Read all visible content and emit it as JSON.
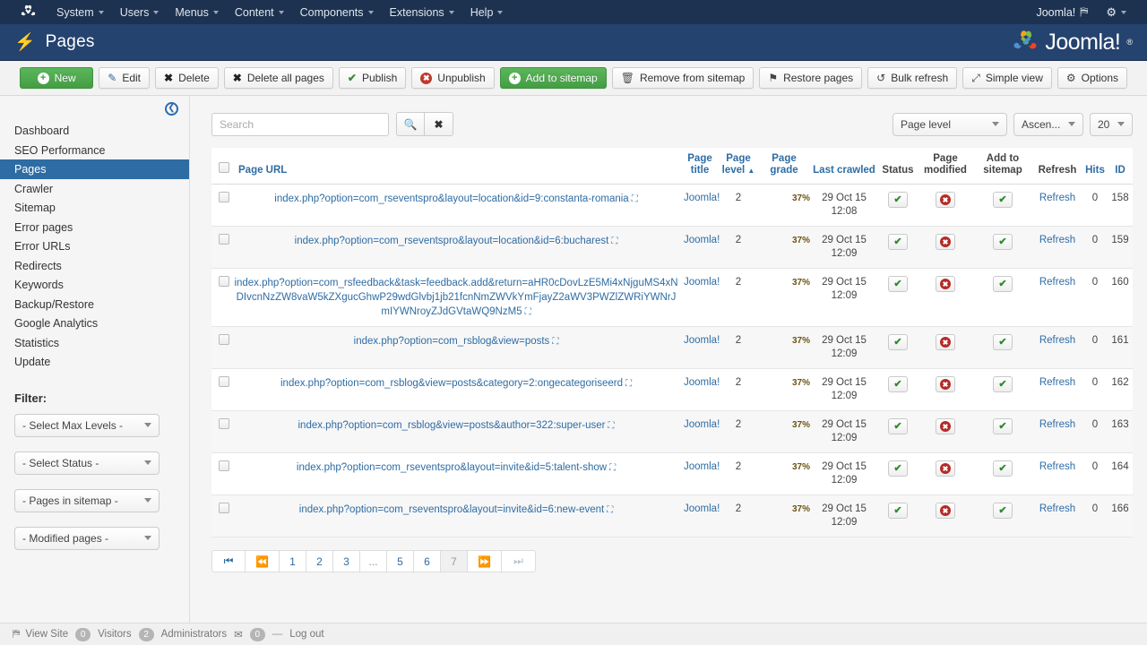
{
  "adminbar": {
    "logo_icon": "joomla-logo-icon",
    "menus": [
      {
        "label": "System"
      },
      {
        "label": "Users"
      },
      {
        "label": "Menus"
      },
      {
        "label": "Content"
      },
      {
        "label": "Components"
      },
      {
        "label": "Extensions"
      },
      {
        "label": "Help"
      }
    ],
    "site_name": "Joomla!",
    "site_preview_icon": "external-link-icon",
    "gear_icon": "gear-icon"
  },
  "header": {
    "icon": "bolt-icon",
    "title": "Pages",
    "brand": "Joomla!",
    "brand_tm": "®"
  },
  "toolbar": {
    "buttons": [
      {
        "label": "New",
        "icon": "plus-circle-icon",
        "style": "green"
      },
      {
        "label": "Edit",
        "icon": "edit-icon",
        "style": "default"
      },
      {
        "label": "Delete",
        "icon": "x-icon",
        "style": "default"
      },
      {
        "label": "Delete all pages",
        "icon": "x-icon",
        "style": "default"
      },
      {
        "label": "Publish",
        "icon": "check-icon",
        "style": "default"
      },
      {
        "label": "Unpublish",
        "icon": "ban-icon",
        "style": "default"
      },
      {
        "label": "Add to sitemap",
        "icon": "plus-circle-icon",
        "style": "green"
      },
      {
        "label": "Remove from sitemap",
        "icon": "trash-icon",
        "style": "default"
      },
      {
        "label": "Restore pages",
        "icon": "flag-icon",
        "style": "default"
      },
      {
        "label": "Bulk refresh",
        "icon": "refresh-icon",
        "style": "default"
      },
      {
        "label": "Simple view",
        "icon": "arrows-icon",
        "style": "default"
      },
      {
        "label": "Options",
        "icon": "gear-icon",
        "style": "default"
      }
    ]
  },
  "sidebar": {
    "collapse_icon": "collapse-left-icon",
    "items": [
      {
        "label": "Dashboard",
        "active": false
      },
      {
        "label": "SEO Performance",
        "active": false
      },
      {
        "label": "Pages",
        "active": true
      },
      {
        "label": "Crawler",
        "active": false
      },
      {
        "label": "Sitemap",
        "active": false
      },
      {
        "label": "Error pages",
        "active": false
      },
      {
        "label": "Error URLs",
        "active": false
      },
      {
        "label": "Redirects",
        "active": false
      },
      {
        "label": "Keywords",
        "active": false
      },
      {
        "label": "Backup/Restore",
        "active": false
      },
      {
        "label": "Google Analytics",
        "active": false
      },
      {
        "label": "Statistics",
        "active": false
      },
      {
        "label": "Update",
        "active": false
      }
    ],
    "filter_heading": "Filter:",
    "filters": [
      {
        "value": "- Select Max Levels -"
      },
      {
        "value": "- Select Status -"
      },
      {
        "value": "- Pages in sitemap -"
      },
      {
        "value": "- Modified pages -"
      }
    ]
  },
  "search": {
    "value": "",
    "placeholder": "Search",
    "search_icon": "search-icon",
    "clear_icon": "close-icon"
  },
  "topfilters": [
    {
      "value": "Page level"
    },
    {
      "value": "Ascen..."
    },
    {
      "value": "20"
    }
  ],
  "table": {
    "columns": [
      {
        "label": "Page URL",
        "sortable": true
      },
      {
        "label": "Page title",
        "sortable": true
      },
      {
        "label": "Page level",
        "sortable": true,
        "sorted": "asc"
      },
      {
        "label": "Page grade",
        "sortable": true
      },
      {
        "label": "Last crawled",
        "sortable": true
      },
      {
        "label": "Status",
        "sortable": false
      },
      {
        "label": "Page modified",
        "sortable": false
      },
      {
        "label": "Add to sitemap",
        "sortable": false
      },
      {
        "label": "Refresh",
        "sortable": false
      },
      {
        "label": "Hits",
        "sortable": true
      },
      {
        "label": "ID",
        "sortable": true
      }
    ],
    "sort_asc_indicator": "▲",
    "refresh_label": "Refresh",
    "rows": [
      {
        "url": "index.php?option=com_rseventspro&layout=location&id=9:constanta-romania",
        "title": "Joomla!",
        "level": "2",
        "grade": "37%",
        "grade_pct": 37,
        "last_crawled_date": "29 Oct 15",
        "last_crawled_time": "12:08",
        "status": "published",
        "page_modified": "no",
        "add_to_sitemap": "yes",
        "refresh": "Refresh",
        "hits": "0",
        "id": "158"
      },
      {
        "url": "index.php?option=com_rseventspro&layout=location&id=6:bucharest",
        "title": "Joomla!",
        "level": "2",
        "grade": "37%",
        "grade_pct": 37,
        "last_crawled_date": "29 Oct 15",
        "last_crawled_time": "12:09",
        "status": "published",
        "page_modified": "no",
        "add_to_sitemap": "yes",
        "refresh": "Refresh",
        "hits": "0",
        "id": "159"
      },
      {
        "url": "index.php?option=com_rsfeedback&task=feedback.add&return=aHR0cDovLzE5Mi4xNjguMS4xNDIvcnNzZW8vaW5kZXgucGhwP29wdGlvbj1jb21fcnNmZWVkYmFjayZ2aWV3PWZlZWRiYWNrJmIYWNroyZJdGVtaWQ9NzM5",
        "title": "Joomla!",
        "level": "2",
        "grade": "37%",
        "grade_pct": 37,
        "last_crawled_date": "29 Oct 15",
        "last_crawled_time": "12:09",
        "status": "published",
        "page_modified": "no",
        "add_to_sitemap": "yes",
        "refresh": "Refresh",
        "hits": "0",
        "id": "160"
      },
      {
        "url": "index.php?option=com_rsblog&view=posts",
        "title": "Joomla!",
        "level": "2",
        "grade": "37%",
        "grade_pct": 37,
        "last_crawled_date": "29 Oct 15",
        "last_crawled_time": "12:09",
        "status": "published",
        "page_modified": "no",
        "add_to_sitemap": "yes",
        "refresh": "Refresh",
        "hits": "0",
        "id": "161"
      },
      {
        "url": "index.php?option=com_rsblog&view=posts&category=2:ongecategoriseerd",
        "title": "Joomla!",
        "level": "2",
        "grade": "37%",
        "grade_pct": 37,
        "last_crawled_date": "29 Oct 15",
        "last_crawled_time": "12:09",
        "status": "published",
        "page_modified": "no",
        "add_to_sitemap": "yes",
        "refresh": "Refresh",
        "hits": "0",
        "id": "162"
      },
      {
        "url": "index.php?option=com_rsblog&view=posts&author=322:super-user",
        "title": "Joomla!",
        "level": "2",
        "grade": "37%",
        "grade_pct": 37,
        "last_crawled_date": "29 Oct 15",
        "last_crawled_time": "12:09",
        "status": "published",
        "page_modified": "no",
        "add_to_sitemap": "yes",
        "refresh": "Refresh",
        "hits": "0",
        "id": "163"
      },
      {
        "url": "index.php?option=com_rseventspro&layout=invite&id=5:talent-show",
        "title": "Joomla!",
        "level": "2",
        "grade": "37%",
        "grade_pct": 37,
        "last_crawled_date": "29 Oct 15",
        "last_crawled_time": "12:09",
        "status": "published",
        "page_modified": "no",
        "add_to_sitemap": "yes",
        "refresh": "Refresh",
        "hits": "0",
        "id": "164"
      },
      {
        "url": "index.php?option=com_rseventspro&layout=invite&id=6:new-event",
        "title": "Joomla!",
        "level": "2",
        "grade": "37%",
        "grade_pct": 37,
        "last_crawled_date": "29 Oct 15",
        "last_crawled_time": "12:09",
        "status": "published",
        "page_modified": "no",
        "add_to_sitemap": "yes",
        "refresh": "Refresh",
        "hits": "0",
        "id": "166"
      }
    ]
  },
  "pagination": [
    {
      "label": "⏮",
      "type": "first",
      "state": "enabled"
    },
    {
      "label": "⏪",
      "type": "prev",
      "state": "enabled"
    },
    {
      "label": "1",
      "type": "page",
      "state": "enabled"
    },
    {
      "label": "2",
      "type": "page",
      "state": "enabled"
    },
    {
      "label": "3",
      "type": "page",
      "state": "enabled"
    },
    {
      "label": "...",
      "type": "dots",
      "state": "disabled"
    },
    {
      "label": "5",
      "type": "page",
      "state": "enabled"
    },
    {
      "label": "6",
      "type": "page",
      "state": "enabled"
    },
    {
      "label": "7",
      "type": "page",
      "state": "active"
    },
    {
      "label": "⏩",
      "type": "next",
      "state": "muted"
    },
    {
      "label": "⏭",
      "type": "last",
      "state": "muted"
    }
  ],
  "footer": {
    "view_site_icon": "external-link-icon",
    "view_site": "View Site",
    "visitors_count": "0",
    "visitors_label": "Visitors",
    "admins_count": "2",
    "admins_label": "Administrators",
    "mail_icon": "envelope-icon",
    "mail_count": "0",
    "logout": "Log out"
  },
  "colors": {
    "accent_blue": "#2e6ca4",
    "header_blue": "#25436f",
    "adminbar_blue": "#1c3250",
    "green": "#449d44",
    "grade_orange": "#e8b44a",
    "status_red": "#b52b27"
  }
}
